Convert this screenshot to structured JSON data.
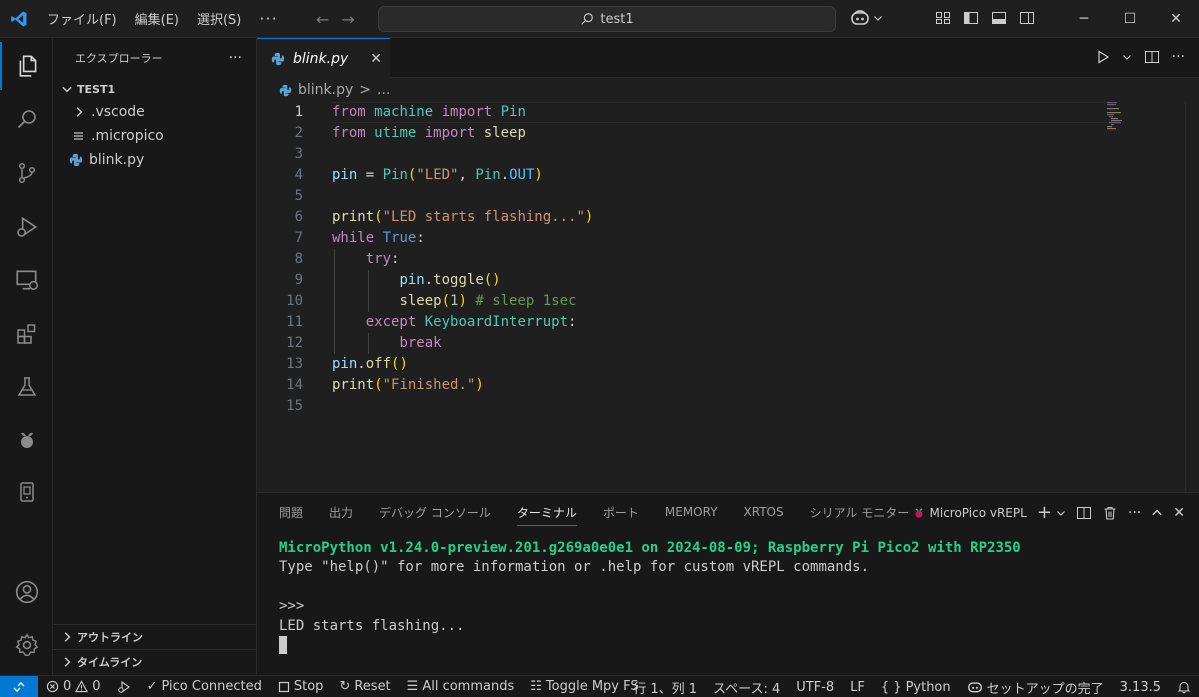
{
  "titlebar": {
    "menu": [
      "ファイル(F)",
      "編集(E)",
      "選択(S)"
    ],
    "more": "···",
    "search_text": "test1"
  },
  "sidebar": {
    "title": "エクスプローラー",
    "more": "···",
    "root": "TEST1",
    "items": [
      {
        "label": ".vscode",
        "icon": "chevron-right-icon"
      },
      {
        "label": ".micropico",
        "icon": "file-lines-icon"
      },
      {
        "label": "blink.py",
        "icon": "python-icon"
      }
    ],
    "outline": "アウトライン",
    "timeline": "タイムライン"
  },
  "editor": {
    "tab_label": "blink.py",
    "breadcrumb_file": "blink.py",
    "breadcrumb_sep": ">",
    "breadcrumb_rest": "...",
    "current_line": 1,
    "lines": [
      "from machine import Pin",
      "from utime import sleep",
      "",
      "pin = Pin(\"LED\", Pin.OUT)",
      "",
      "print(\"LED starts flashing...\")",
      "while True:",
      "    try:",
      "        pin.toggle()",
      "        sleep(1) # sleep 1sec",
      "    except KeyboardInterrupt:",
      "        break",
      "pin.off()",
      "print(\"Finished.\")",
      ""
    ]
  },
  "panel": {
    "tabs": [
      "問題",
      "出力",
      "デバッグ コンソール",
      "ターミナル",
      "ポート",
      "MEMORY",
      "XRTOS",
      "シリアル モニター"
    ],
    "active_tab": "ターミナル",
    "terminal_name": "MicroPico vREPL",
    "terminal_lines": [
      "MicroPython v1.24.0-preview.201.g269a0e0e1 on 2024-08-09; Raspberry Pi Pico2 with RP2350",
      "Type \"help()\" for more information or .help for custom vREPL commands.",
      "",
      ">>>",
      "LED starts flashing..."
    ]
  },
  "statusbar": {
    "errors": "0",
    "warnings": "0",
    "pico_connected": "Pico Connected",
    "stop": "Stop",
    "reset": "Reset",
    "all_commands": "All commands",
    "toggle_fs": "Toggle Mpy FS",
    "position": "行 1、列 1",
    "spaces": "スペース: 4",
    "encoding": "UTF-8",
    "eol": "LF",
    "language_brace": "{ }",
    "language": "Python",
    "setup": "セットアップの完了",
    "version": "3.13.5"
  },
  "colors": {
    "accent": "#0078d4",
    "terminal_green": "#23d18b"
  }
}
